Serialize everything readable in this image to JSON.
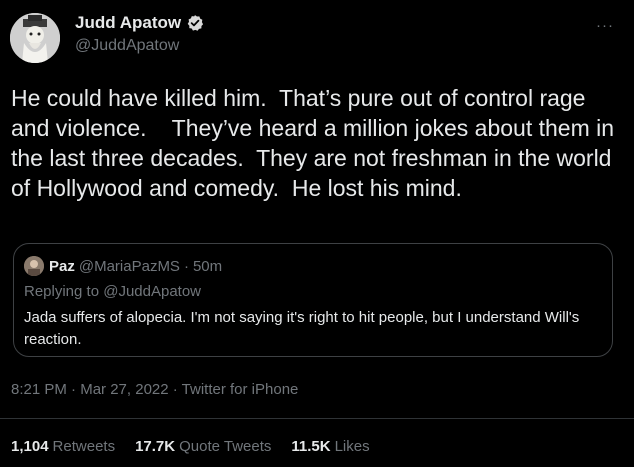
{
  "author": {
    "display_name": "Judd Apatow",
    "handle": "@JuddApatow",
    "avatar_icon": "profile-photo",
    "verified_icon": "verified-badge-icon"
  },
  "more_label": "···",
  "tweet": {
    "text": "He could have killed him.  That’s pure out of control rage and violence.    They’ve heard a million jokes about them in the last three decades.  They are not freshman in the world of Hollywood and comedy.  He lost his mind."
  },
  "quote": {
    "name": "Paz",
    "handle": "@MariaPazMS",
    "dot": "·",
    "time": "50m",
    "replying": "Replying to @JuddApatow",
    "text": "Jada suffers of alopecia. I'm not saying it's right to hit people,  but I understand Will's reaction."
  },
  "meta": {
    "time": "8:21 PM",
    "sep1": " · ",
    "date": "Mar 27, 2022",
    "sep2": " · ",
    "source": "Twitter for iPhone"
  },
  "stats": {
    "retweets": {
      "count": "1,104",
      "label": "Retweets"
    },
    "quotes": {
      "count": "17.7K",
      "label": "Quote Tweets"
    },
    "likes": {
      "count": "11.5K",
      "label": "Likes"
    }
  },
  "colors": {
    "background": "#000000",
    "primary_text": "#e7e9ea",
    "secondary_text": "#71767b",
    "verified": "#1d9bf0"
  }
}
